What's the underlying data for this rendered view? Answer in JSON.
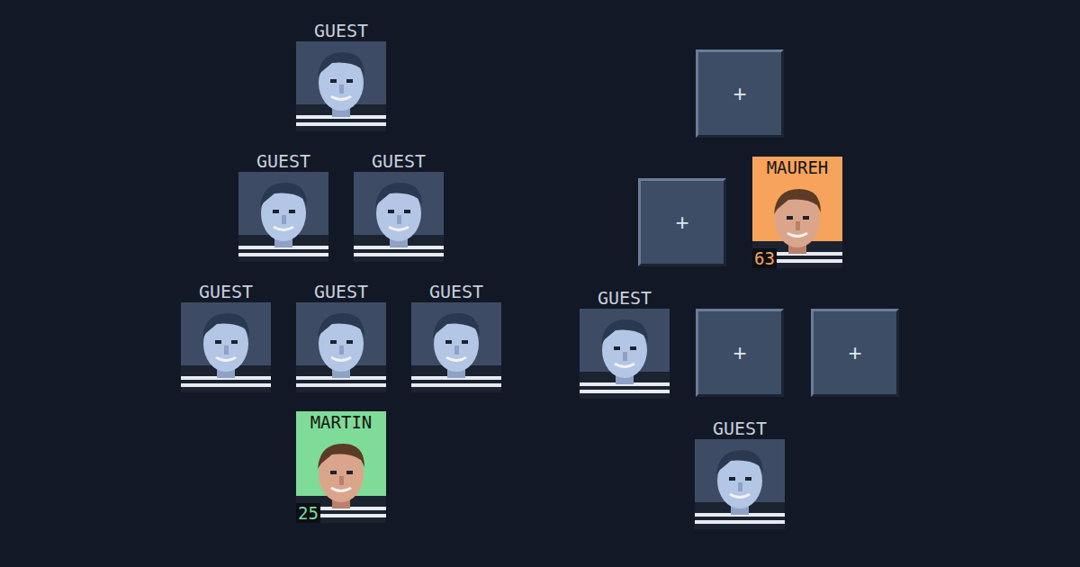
{
  "lineups": [
    {
      "rows": [
        [
          {
            "kind": "guest",
            "name": "GUEST"
          }
        ],
        [
          {
            "kind": "guest",
            "name": "GUEST"
          },
          {
            "kind": "guest",
            "name": "GUEST"
          }
        ],
        [
          {
            "kind": "guest",
            "name": "GUEST"
          },
          {
            "kind": "guest",
            "name": "GUEST"
          },
          {
            "kind": "guest",
            "name": "GUEST"
          }
        ],
        [
          {
            "kind": "player",
            "name": "MARTIN",
            "level": "25",
            "color": "#7fdc98"
          }
        ]
      ]
    },
    {
      "rows": [
        [
          {
            "kind": "empty",
            "label": "+"
          }
        ],
        [
          {
            "kind": "empty",
            "label": "+"
          },
          {
            "kind": "player",
            "name": "MAUREH",
            "level": "63",
            "color": "#f7a35c"
          }
        ],
        [
          {
            "kind": "guest",
            "name": "GUEST"
          },
          {
            "kind": "empty",
            "label": "+"
          },
          {
            "kind": "empty",
            "label": "+"
          }
        ],
        [
          {
            "kind": "guest",
            "name": "GUEST"
          }
        ]
      ]
    }
  ]
}
